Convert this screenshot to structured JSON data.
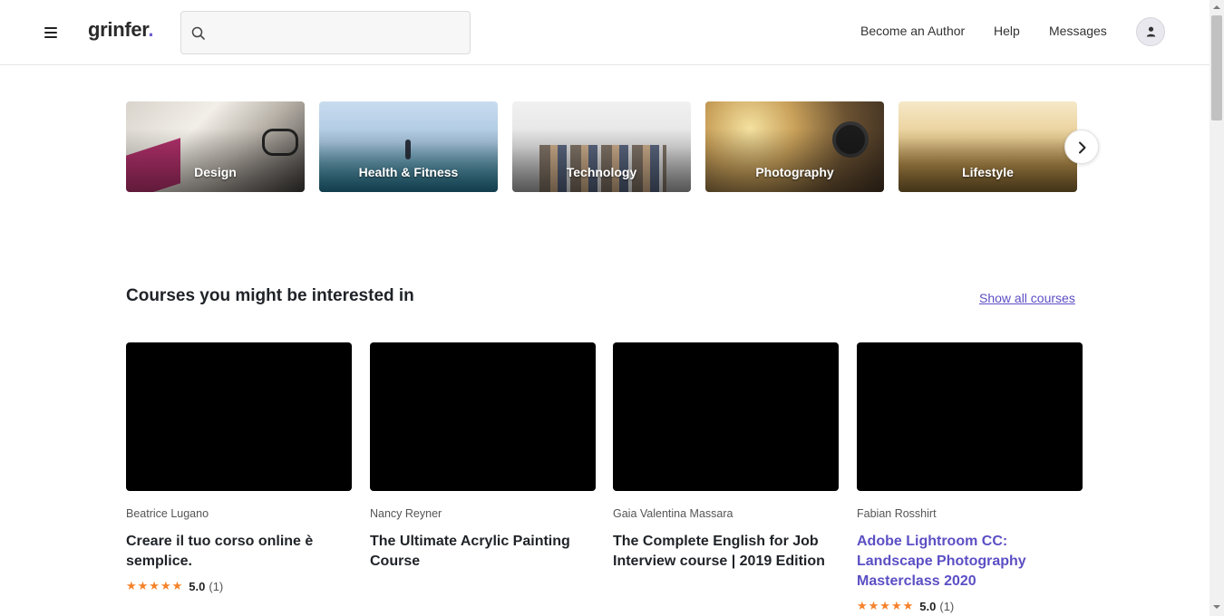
{
  "header": {
    "logo_text": "grinfer",
    "logo_dot": ".",
    "search_placeholder": "",
    "nav": [
      "Become an Author",
      "Help",
      "Messages"
    ]
  },
  "categories": [
    {
      "label": "Design"
    },
    {
      "label": "Health & Fitness"
    },
    {
      "label": "Technology"
    },
    {
      "label": "Photography"
    },
    {
      "label": "Lifestyle"
    }
  ],
  "courses_section": {
    "title": "Courses you might be interested in",
    "show_all": "Show all courses"
  },
  "courses": [
    {
      "author": "Beatrice Lugano",
      "title": "Creare il tuo corso online è semplice.",
      "stars": "★★★★★",
      "rating": "5.0",
      "count": "(1)"
    },
    {
      "author": "Nancy Reyner",
      "title": "The Ultimate Acrylic Painting Course"
    },
    {
      "author": "Gaia Valentina Massara",
      "title": "The Complete English for Job Interview course | 2019 Edition"
    },
    {
      "author": "Fabian Rosshirt",
      "title": "Adobe Lightroom CC: Landscape Photography Masterclass 2020",
      "stars": "★★★★★",
      "rating": "5.0",
      "count": "(1)"
    }
  ],
  "colors": {
    "accent": "#5b4fc4",
    "star": "#f5822b"
  }
}
